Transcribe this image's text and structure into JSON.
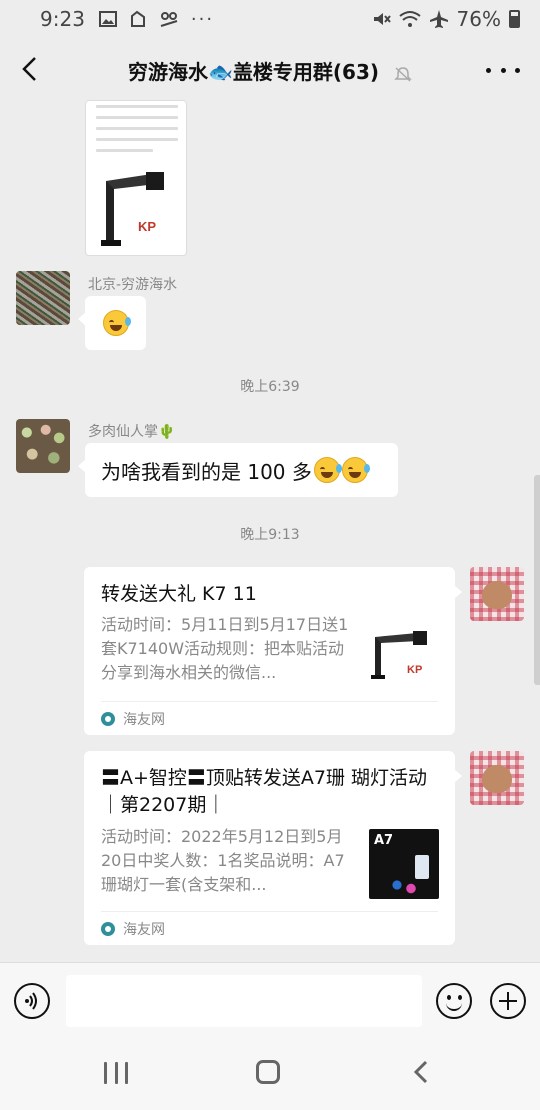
{
  "status_bar": {
    "time": "9:23",
    "left_icons": [
      "gallery-icon",
      "clipboard-icon",
      "voicemail-icon",
      "more-notifications-icon"
    ],
    "right_icons": [
      "mute-icon",
      "wifi-icon",
      "airplane-icon"
    ],
    "battery": "76%"
  },
  "header": {
    "title_pre": "穷游海水",
    "title_fish": "🐟",
    "title_post": "盖楼专用群(63)",
    "muted": true
  },
  "messages": [
    {
      "type": "image",
      "from": "previous",
      "thumb_text": "KP"
    },
    {
      "type": "text",
      "sender": "北京-穷游海水",
      "content": "😂",
      "avatar": "grass-avatar"
    },
    {
      "type": "timestamp",
      "text": "晚上6:39"
    },
    {
      "type": "text",
      "sender": "多肉仙人掌🌵",
      "content": "为啥我看到的是 100 多",
      "trailing_emoji": "😂😂",
      "avatar": "succulent-avatar"
    },
    {
      "type": "timestamp",
      "text": "晚上9:13"
    }
  ],
  "cards": [
    {
      "title": "转发送大礼 K7 11",
      "description": "活动时间：5月11日到5月17日送1套K7140W活动规则：把本贴活动分享到海水相关的微信...",
      "source": "海友网",
      "thumb_label": "KP"
    },
    {
      "title": "〓A+智控〓顶贴转发送A7珊 瑚灯活动｜第2207期｜",
      "description": "活动时间：2022年5月12日到5月20日中奖人数：1名奖品说明：A7珊瑚灯一套(含支架和...",
      "source": "海友网",
      "thumb_label": "A7"
    }
  ],
  "input": {
    "placeholder": ""
  },
  "colors": {
    "background": "#ededed",
    "bubble": "#ffffff",
    "emoji_yellow": "#f9c93a"
  }
}
